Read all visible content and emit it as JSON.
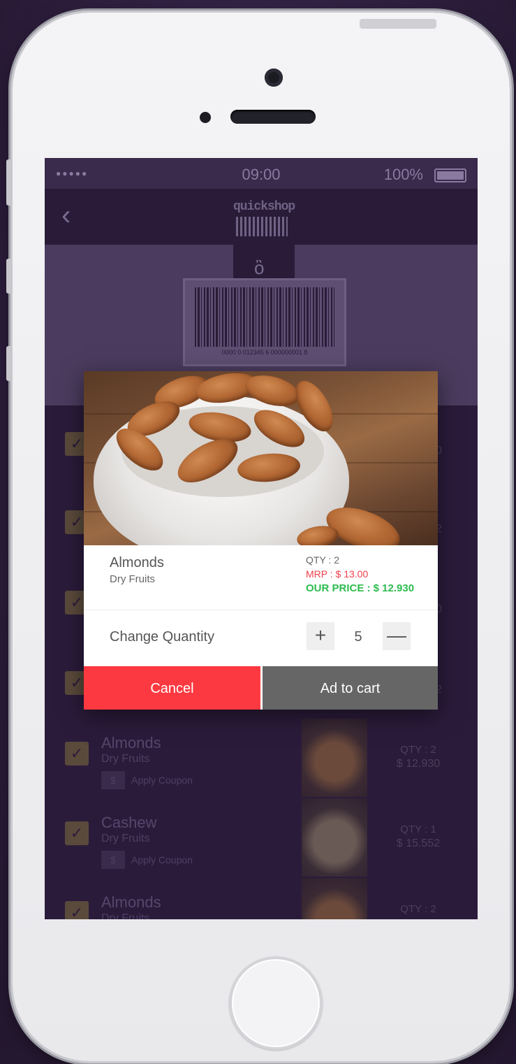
{
  "status": {
    "dots": "●●●●●",
    "time": "09:00",
    "battery": "100%"
  },
  "nav": {
    "back_icon": "‹",
    "logo": "quickshop"
  },
  "scanner": {
    "barcode_number": "0000 0 012345 6 000000001 8"
  },
  "list": {
    "rows": [
      {
        "name": "Almonds",
        "category": "Dry Fruits",
        "coupon": "Apply Coupon",
        "coupon_icon": "$",
        "qty": "QTY : 2",
        "price": "$ 12.930"
      },
      {
        "name": "Cashew",
        "category": "Dry Fruits",
        "coupon": "Apply Coupon",
        "coupon_icon": "$",
        "qty": "QTY : 1",
        "price": "$ 15.552"
      },
      {
        "name": "Almonds",
        "category": "Dry Fruits",
        "qty": "QTY : 2"
      }
    ],
    "peek_sides": [
      "0",
      "2",
      "0",
      "2"
    ]
  },
  "modal": {
    "product_name": "Almonds",
    "product_category": "Dry Fruits",
    "qty": "QTY : 2",
    "mrp": "MRP : $ 13.00",
    "our_price": "OUR PRICE : $ 12.930",
    "change_quantity_label": "Change Quantity",
    "plus": "+",
    "minus": "—",
    "quantity": "5",
    "cancel": "Cancel",
    "add_to_cart": "Ad to cart"
  },
  "colors": {
    "accent_red": "#fc3840",
    "price_green": "#2dbb4f",
    "mrp_red": "#f0404a",
    "button_gray": "#666666"
  }
}
